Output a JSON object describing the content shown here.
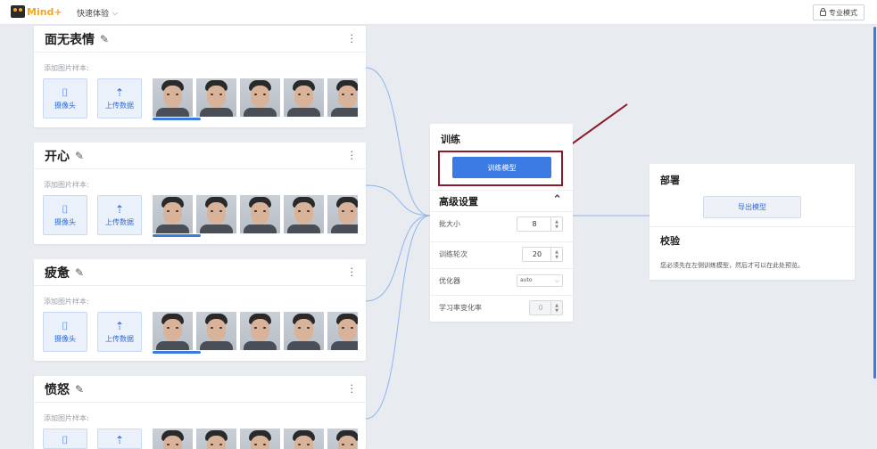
{
  "header": {
    "logo_text": "Mind+",
    "menu_label": "快速体验",
    "pro_mode_label": "专业模式"
  },
  "classes": [
    {
      "title": "面无表情",
      "sample_label": "添加图片样本:",
      "webcam_label": "摄像头",
      "upload_label": "上传数据",
      "sample_progress": 0.15
    },
    {
      "title": "开心",
      "sample_label": "添加图片样本:",
      "webcam_label": "摄像头",
      "upload_label": "上传数据",
      "sample_progress": 0.15
    },
    {
      "title": "疲惫",
      "sample_label": "添加图片样本:",
      "webcam_label": "摄像头",
      "upload_label": "上传数据",
      "sample_progress": 0.15
    },
    {
      "title": "愤怒",
      "sample_label": "添加图片样本:",
      "webcam_label": "摄像头",
      "upload_label": "上传数据",
      "sample_progress": 0
    }
  ],
  "training": {
    "title": "训练",
    "train_button": "训练模型",
    "advanced_title": "高级设置",
    "batch_size_label": "批大小",
    "batch_size_value": "8",
    "epochs_label": "训练轮次",
    "epochs_value": "20",
    "optimizer_label": "优化器",
    "optimizer_value": "auto",
    "lr_label": "学习率变化率",
    "lr_value": "0"
  },
  "deploy": {
    "title": "部署",
    "export_button": "导出模型",
    "verify_title": "校验",
    "verify_note": "您必须先在左侧训练模型，然后才可以在此处预览。"
  },
  "colors": {
    "accent": "#3b7be3",
    "highlight_box": "#8b1a2a",
    "connector": "#8fb4ec"
  },
  "icons": {
    "camera": "camera-icon",
    "upload": "upload-icon",
    "pencil": "pencil-icon",
    "kebab": "more-vertical-icon",
    "lock": "lock-icon",
    "chevron": "chevron-down-icon"
  }
}
